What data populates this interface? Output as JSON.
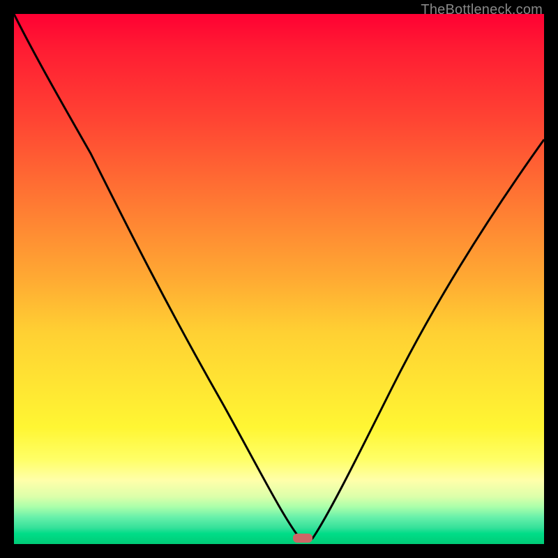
{
  "watermark": "TheBottleneck.com",
  "chart_data": {
    "type": "line",
    "title": "",
    "xlabel": "",
    "ylabel": "",
    "xlim": [
      0,
      100
    ],
    "ylim": [
      0,
      100
    ],
    "grid": false,
    "legend": false,
    "series": [
      {
        "name": "bottleneck-curve",
        "x": [
          0,
          3,
          8,
          15,
          22,
          30,
          38,
          45,
          50,
          53,
          55,
          57,
          60,
          65,
          72,
          80,
          88,
          95,
          100
        ],
        "values": [
          100,
          94,
          85,
          73,
          61,
          47,
          33,
          20,
          10,
          4,
          0.5,
          3,
          8,
          18,
          32,
          47,
          60,
          70,
          77
        ]
      }
    ],
    "marker": {
      "x": 54.5,
      "y": 0.5,
      "color": "#cc6666"
    },
    "background_gradient": {
      "type": "vertical",
      "stops": [
        {
          "pos": 0,
          "color": "#ff0033"
        },
        {
          "pos": 50,
          "color": "#ffaa33"
        },
        {
          "pos": 78,
          "color": "#fff633"
        },
        {
          "pos": 100,
          "color": "#00cc77"
        }
      ]
    }
  }
}
